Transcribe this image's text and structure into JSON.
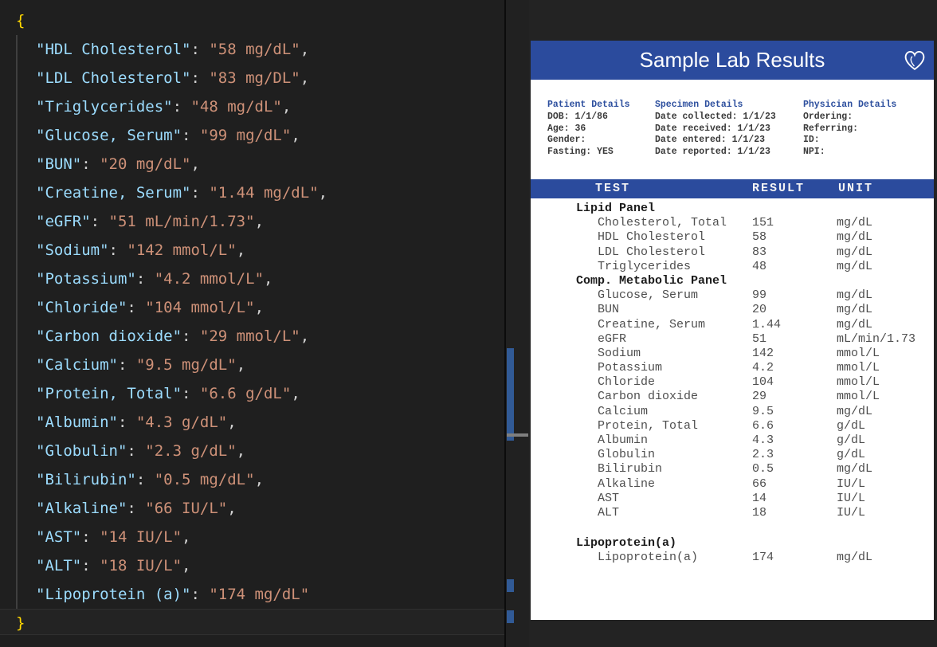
{
  "editor": {
    "language": "json",
    "open_brace": "{",
    "close_brace": "}",
    "entries": [
      {
        "key": "HDL Cholesterol",
        "value": "58 mg/dL"
      },
      {
        "key": "LDL Cholesterol",
        "value": "83 mg/DL"
      },
      {
        "key": "Triglycerides",
        "value": "48 mg/dL"
      },
      {
        "key": "Glucose, Serum",
        "value": "99 mg/dL"
      },
      {
        "key": "BUN",
        "value": "20 mg/dL"
      },
      {
        "key": "Creatine, Serum",
        "value": "1.44 mg/dL"
      },
      {
        "key": "eGFR",
        "value": "51 mL/min/1.73"
      },
      {
        "key": "Sodium",
        "value": "142 mmol/L"
      },
      {
        "key": "Potassium",
        "value": "4.2 mmol/L"
      },
      {
        "key": "Chloride",
        "value": "104 mmol/L"
      },
      {
        "key": "Carbon dioxide",
        "value": "29 mmol/L"
      },
      {
        "key": "Calcium",
        "value": "9.5 mg/dL"
      },
      {
        "key": "Protein, Total",
        "value": "6.6 g/dL"
      },
      {
        "key": "Albumin",
        "value": "4.3 g/dL"
      },
      {
        "key": "Globulin",
        "value": "2.3 g/dL"
      },
      {
        "key": "Bilirubin",
        "value": "0.5 mg/dL"
      },
      {
        "key": "Alkaline",
        "value": "66 IU/L"
      },
      {
        "key": "AST",
        "value": "14 IU/L"
      },
      {
        "key": "ALT",
        "value": "18 IU/L"
      },
      {
        "key": "Lipoprotein (a)",
        "value": "174 mg/dL"
      }
    ],
    "colors": {
      "background": "#1f1f1f",
      "key": "#9cdcfe",
      "value": "#ce9178",
      "punctuation": "#d4d4d4",
      "brace": "#ffd700",
      "modified_line_marker": "#315a96"
    }
  },
  "preview": {
    "title": "Sample Lab Results",
    "logo_icon": "heart-logo",
    "accent_color": "#2b4b9d",
    "details": {
      "columns": [
        {
          "heading": "Patient Details",
          "lines": [
            "DOB: 1/1/86",
            "Age: 36",
            "Gender:",
            "Fasting: YES"
          ]
        },
        {
          "heading": "Specimen Details",
          "lines": [
            "Date collected: 1/1/23",
            "Date received: 1/1/23",
            "Date entered: 1/1/23",
            "Date reported: 1/1/23"
          ]
        },
        {
          "heading": "Physician Details",
          "lines": [
            "Ordering:",
            "Referring:",
            "ID:",
            "NPI:"
          ]
        }
      ]
    },
    "table": {
      "headers": [
        "TEST",
        "RESULT",
        "UNIT"
      ],
      "groups": [
        {
          "name": "Lipid Panel",
          "rows": [
            [
              "Cholesterol, Total",
              "151",
              "mg/dL"
            ],
            [
              "HDL Cholesterol",
              "58",
              "mg/dL"
            ],
            [
              "LDL Cholesterol",
              "83",
              "mg/dL"
            ],
            [
              "Triglycerides",
              "48",
              "mg/dL"
            ]
          ]
        },
        {
          "name": "Comp. Metabolic Panel",
          "rows": [
            [
              "Glucose, Serum",
              "99",
              "mg/dL"
            ],
            [
              "BUN",
              "20",
              "mg/dL"
            ],
            [
              "Creatine, Serum",
              "1.44",
              "mg/dL"
            ],
            [
              "eGFR",
              "51",
              "mL/min/1.73"
            ],
            [
              "Sodium",
              "142",
              "mmol/L"
            ],
            [
              "Potassium",
              "4.2",
              "mmol/L"
            ],
            [
              "Chloride",
              "104",
              "mmol/L"
            ],
            [
              "Carbon dioxide",
              "29",
              "mmol/L"
            ],
            [
              "Calcium",
              "9.5",
              "mg/dL"
            ],
            [
              "Protein, Total",
              "6.6",
              "g/dL"
            ],
            [
              "Albumin",
              "4.3",
              "g/dL"
            ],
            [
              "Globulin",
              "2.3",
              "g/dL"
            ],
            [
              "Bilirubin",
              "0.5",
              "mg/dL"
            ],
            [
              "Alkaline",
              "66",
              "IU/L"
            ],
            [
              "AST",
              "14",
              "IU/L"
            ],
            [
              "ALT",
              "18",
              "IU/L"
            ]
          ]
        },
        {
          "name": "Lipoprotein(a)",
          "gap_before": true,
          "rows": [
            [
              "Lipoprotein(a)",
              "174",
              "mg/dL"
            ]
          ]
        }
      ]
    }
  }
}
